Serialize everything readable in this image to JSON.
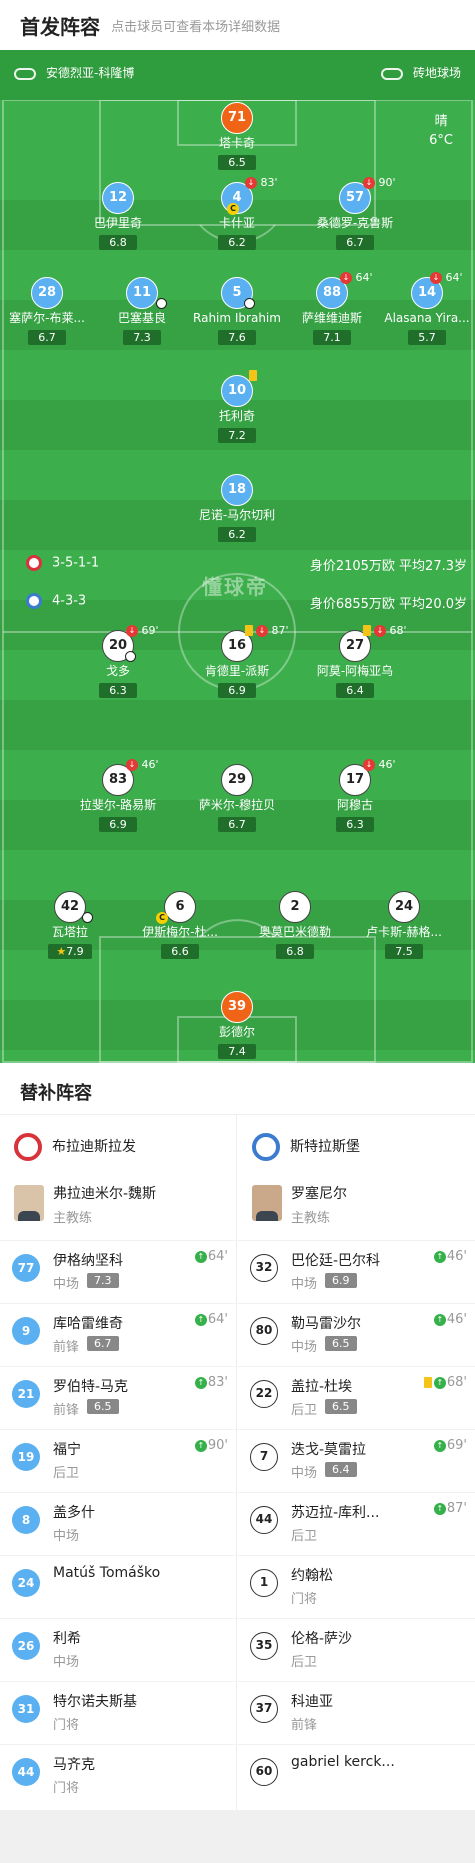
{
  "header": {
    "title": "首发阵容",
    "subtitle": "点击球员可查看本场详细数据"
  },
  "pitch_info": {
    "stadium": "安德烈亚-科隆博",
    "surface": "砖地球场",
    "weather": "晴",
    "temperature": "6°C",
    "watermark": "懂球帝"
  },
  "home": {
    "formation": "3-5-1-1",
    "summary": "身价2105万欧 平均27.3岁",
    "players": {
      "p71": {
        "num": "71",
        "name": "塔卡奇",
        "rating": "6.5"
      },
      "p12": {
        "num": "12",
        "name": "巴伊里奇",
        "rating": "6.8"
      },
      "p4": {
        "num": "4",
        "name": "卡什亚",
        "rating": "6.2",
        "sub_min": "83'"
      },
      "p57": {
        "num": "57",
        "name": "桑德罗-克鲁斯",
        "rating": "6.7",
        "sub_min": "90'"
      },
      "p28": {
        "num": "28",
        "name": "塞萨尔-布莱...",
        "rating": "6.7"
      },
      "p11": {
        "num": "11",
        "name": "巴塞基良",
        "rating": "7.3"
      },
      "p5": {
        "num": "5",
        "name": "Rahim Ibrahim",
        "rating": "7.6"
      },
      "p88": {
        "num": "88",
        "name": "萨维维迪斯",
        "rating": "7.1",
        "sub_min": "64'"
      },
      "p14": {
        "num": "14",
        "name": "Alasana Yira...",
        "rating": "5.7",
        "sub_min": "64'"
      },
      "p10": {
        "num": "10",
        "name": "托利奇",
        "rating": "7.2"
      },
      "p18": {
        "num": "18",
        "name": "尼诺-马尔切利",
        "rating": "6.2"
      }
    }
  },
  "away": {
    "formation": "4-3-3",
    "summary": "身价6855万欧 平均20.0岁",
    "players": {
      "p20": {
        "num": "20",
        "name": "戈多",
        "rating": "6.3",
        "sub_min": "69'"
      },
      "p16": {
        "num": "16",
        "name": "肯德里-派斯",
        "rating": "6.9",
        "sub_min": "87'"
      },
      "p27": {
        "num": "27",
        "name": "阿莫-阿梅亚乌",
        "rating": "6.4",
        "sub_min": "68'"
      },
      "p83": {
        "num": "83",
        "name": "拉斐尔-路易斯",
        "rating": "6.9",
        "sub_min": "46'"
      },
      "p29": {
        "num": "29",
        "name": "萨米尔-穆拉贝",
        "rating": "6.7"
      },
      "p17": {
        "num": "17",
        "name": "阿穆古",
        "rating": "6.3",
        "sub_min": "46'"
      },
      "p42": {
        "num": "42",
        "name": "瓦塔拉",
        "rating": "7.9"
      },
      "p6": {
        "num": "6",
        "name": "伊斯梅尔-杜...",
        "rating": "6.6"
      },
      "p2": {
        "num": "2",
        "name": "奥莫巴米德勒",
        "rating": "6.8"
      },
      "p24": {
        "num": "24",
        "name": "卢卡斯-赫格...",
        "rating": "7.5"
      },
      "p39": {
        "num": "39",
        "name": "彭德尔",
        "rating": "7.4"
      }
    }
  },
  "subs": {
    "title": "替补阵容",
    "home": {
      "team": "布拉迪斯拉发",
      "coach": {
        "name": "弗拉迪米尔-魏斯",
        "role": "主教练"
      },
      "list": [
        {
          "num": "77",
          "name": "伊格纳坚科",
          "pos": "中场",
          "rating": "7.3",
          "min": "64'"
        },
        {
          "num": "9",
          "name": "库哈雷维奇",
          "pos": "前锋",
          "rating": "6.7",
          "min": "64'"
        },
        {
          "num": "21",
          "name": "罗伯特-马克",
          "pos": "前锋",
          "rating": "6.5",
          "min": "83'"
        },
        {
          "num": "19",
          "name": "福宁",
          "pos": "后卫",
          "rating": "",
          "min": "90'"
        },
        {
          "num": "8",
          "name": "盖多什",
          "pos": "中场",
          "rating": "",
          "min": ""
        },
        {
          "num": "24",
          "name": "Matúš Tomáško",
          "pos": "",
          "rating": "",
          "min": ""
        },
        {
          "num": "26",
          "name": "利希",
          "pos": "中场",
          "rating": "",
          "min": ""
        },
        {
          "num": "31",
          "name": "特尔诺夫斯基",
          "pos": "门将",
          "rating": "",
          "min": ""
        },
        {
          "num": "44",
          "name": "马齐克",
          "pos": "门将",
          "rating": "",
          "min": ""
        }
      ]
    },
    "away": {
      "team": "斯特拉斯堡",
      "coach": {
        "name": "罗塞尼尔",
        "role": "主教练"
      },
      "list": [
        {
          "num": "32",
          "name": "巴伦廷-巴尔科",
          "pos": "中场",
          "rating": "6.9",
          "min": "46'"
        },
        {
          "num": "80",
          "name": "勒马雷沙尔",
          "pos": "中场",
          "rating": "6.5",
          "min": "46'"
        },
        {
          "num": "22",
          "name": "盖拉-杜埃",
          "pos": "后卫",
          "rating": "6.5",
          "min": "68'"
        },
        {
          "num": "7",
          "name": "迭戈-莫雷拉",
          "pos": "中场",
          "rating": "6.4",
          "min": "69'"
        },
        {
          "num": "44",
          "name": "苏迈拉-库利...",
          "pos": "后卫",
          "rating": "",
          "min": "87'"
        },
        {
          "num": "1",
          "name": "约翰松",
          "pos": "门将",
          "rating": "",
          "min": ""
        },
        {
          "num": "35",
          "name": "伦格-萨沙",
          "pos": "后卫",
          "rating": "",
          "min": ""
        },
        {
          "num": "37",
          "name": "科迪亚",
          "pos": "前锋",
          "rating": "",
          "min": ""
        },
        {
          "num": "60",
          "name": "gabriel kerck...",
          "pos": "",
          "rating": "",
          "min": ""
        }
      ]
    }
  },
  "colors": {
    "pitch": "#3cae4b",
    "home_player": "#5ab0f0",
    "goalkeeper": "#f06418",
    "rating_bg": "#1f6f2b",
    "sub_in": "#35b04a",
    "sub_out": "#e53935"
  },
  "icons": [
    "whistle-icon",
    "stadium-icon",
    "sub-out-icon",
    "sub-in-icon",
    "yellow-card-icon",
    "captain-icon",
    "ball-icon",
    "star-icon"
  ]
}
